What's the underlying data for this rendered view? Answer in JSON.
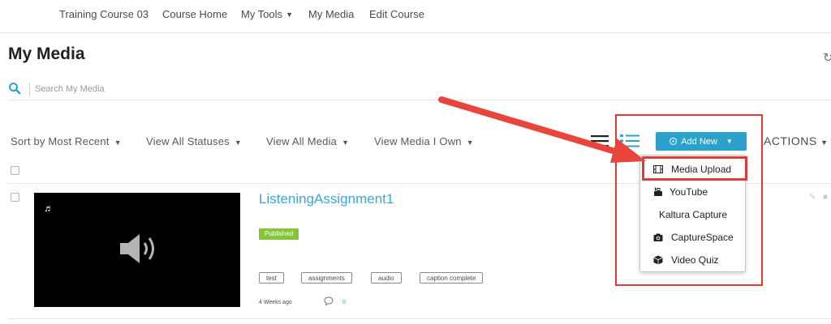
{
  "topnav": {
    "items": [
      {
        "label": "Training Course 03"
      },
      {
        "label": "Course Home"
      },
      {
        "label": "My Tools"
      },
      {
        "label": "My Media"
      },
      {
        "label": "Edit Course"
      }
    ]
  },
  "page": {
    "title": "My Media",
    "refresh_icon": "refresh-icon"
  },
  "search": {
    "placeholder": "Search My Media",
    "icon": "search-icon"
  },
  "filters": [
    {
      "label": "Sort by Most Recent"
    },
    {
      "label": "View All Statuses"
    },
    {
      "label": "View All Media"
    },
    {
      "label": "View Media I Own"
    }
  ],
  "toolbar": {
    "add_new_label": "Add New",
    "actions_label": "ACTIONS"
  },
  "add_new_menu": {
    "items": [
      {
        "label": "Media Upload",
        "icon": "film-icon"
      },
      {
        "label": "YouTube",
        "icon": "youtube-icon"
      },
      {
        "label": "Kaltura Capture",
        "icon": ""
      },
      {
        "label": "CaptureSpace",
        "icon": "camera-icon"
      },
      {
        "label": "Video Quiz",
        "icon": "cube-icon"
      }
    ]
  },
  "media": {
    "title": "ListeningAssignment1",
    "status": "Published",
    "tags": [
      "test",
      "assignments",
      "audio",
      "caption complete"
    ],
    "time": "4 Weeks ago",
    "comments": "0"
  },
  "colors": {
    "accent": "#2ba1cb",
    "link": "#3ba8d6",
    "published": "#84c53a",
    "annotation": "#e03a3a"
  }
}
